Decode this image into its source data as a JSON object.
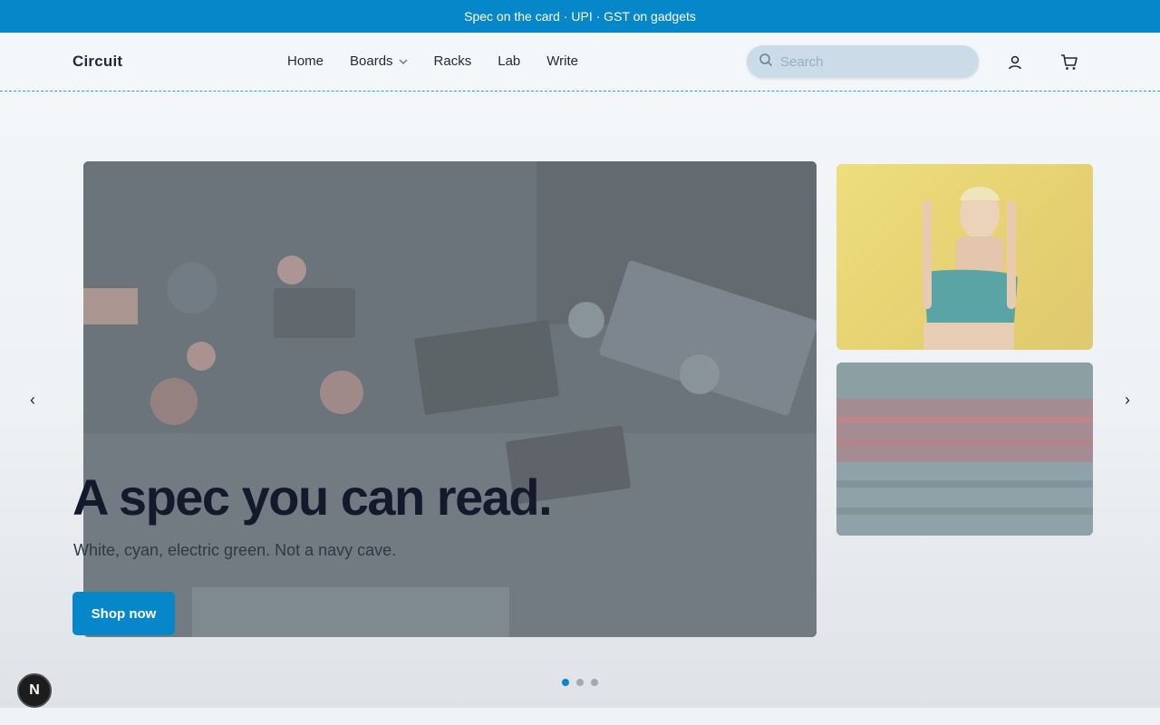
{
  "announcement": "Spec on the card · UPI · GST on gadgets",
  "header": {
    "logo": "Circuit",
    "nav": [
      {
        "label": "Home",
        "has_dropdown": false
      },
      {
        "label": "Boards",
        "has_dropdown": true
      },
      {
        "label": "Racks",
        "has_dropdown": false
      },
      {
        "label": "Lab",
        "has_dropdown": false
      },
      {
        "label": "Write",
        "has_dropdown": false
      }
    ],
    "search": {
      "placeholder": "Search",
      "value": "",
      "icon": "search-icon"
    },
    "account_icon": "user-icon",
    "cart_icon": "cart-icon"
  },
  "hero": {
    "headline": "A spec you can read.",
    "subline": "White, cyan, electric green. Not a navy cave.",
    "cta_label": "Shop now",
    "prev_arrow": "‹",
    "next_arrow": "›",
    "slide_count": 3,
    "active_slide": 1,
    "images": [
      {
        "name": "circuit-board-image"
      },
      {
        "name": "woman-yellow-wall-image"
      },
      {
        "name": "theater-audience-image"
      }
    ]
  },
  "dev_badge": "N",
  "colors": {
    "accent": "#0687c9",
    "background": "#f2f6f9",
    "text": "#141a2b"
  }
}
